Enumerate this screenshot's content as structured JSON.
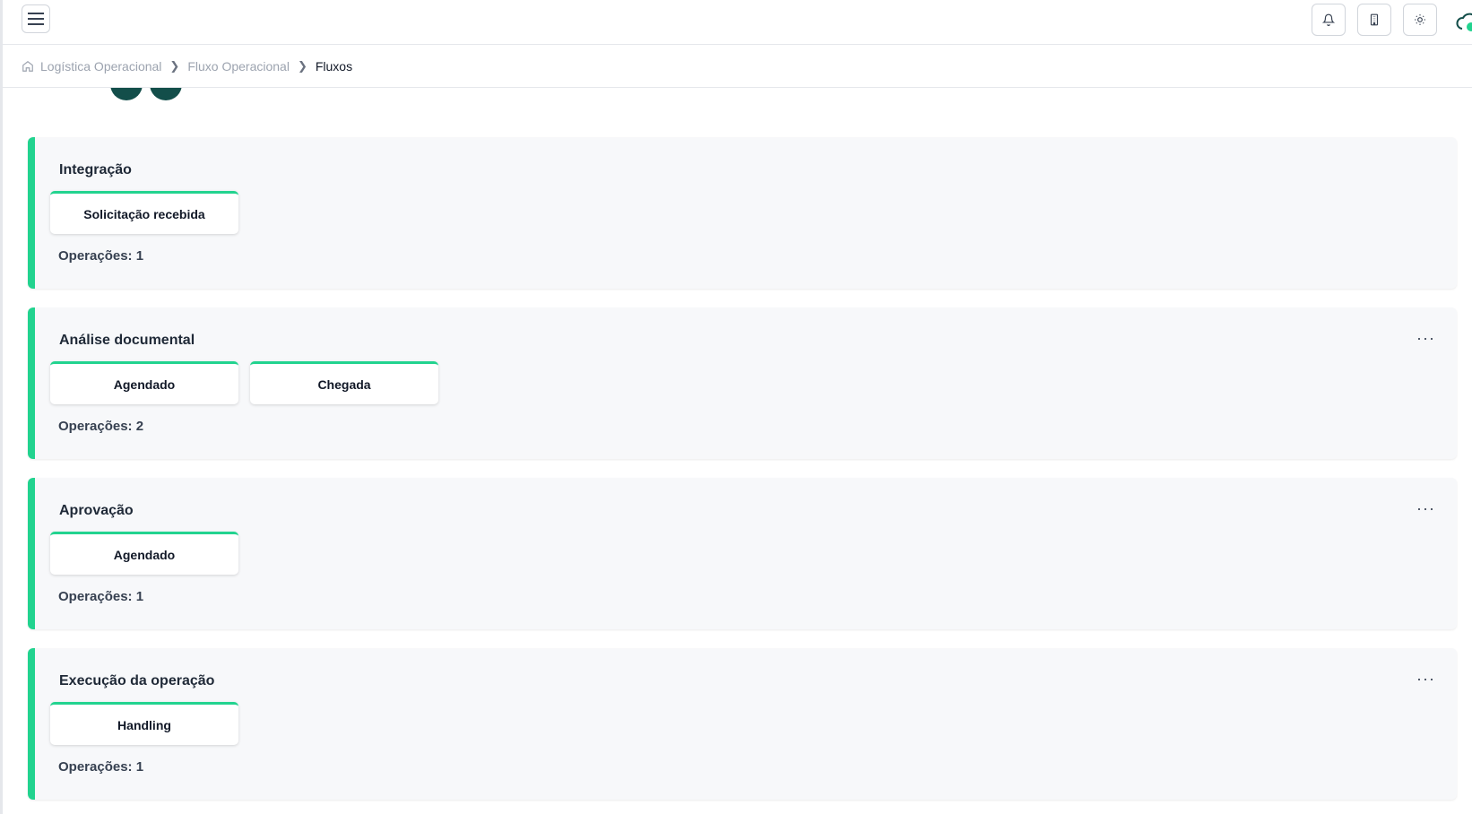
{
  "header": {
    "menu_icon": "hamburger-menu-icon",
    "actions": [
      {
        "name": "notifications-button",
        "icon": "bell-icon"
      },
      {
        "name": "building-button",
        "icon": "building-icon"
      },
      {
        "name": "theme-toggle-button",
        "icon": "sun-icon"
      }
    ],
    "logo_icon": "cloud-logo-icon"
  },
  "breadcrumb": {
    "home_icon": "home-icon",
    "items": [
      "Logística Operacional",
      "Fluxo Operacional",
      "Fluxos"
    ]
  },
  "stages": [
    {
      "title": "Integração",
      "cards": [
        "Solicitação recebida"
      ],
      "ops_label": "Operações: 1",
      "has_menu": false
    },
    {
      "title": "Análise documental",
      "cards": [
        "Agendado",
        "Chegada"
      ],
      "ops_label": "Operações: 2",
      "has_menu": true
    },
    {
      "title": "Aprovação",
      "cards": [
        "Agendado"
      ],
      "ops_label": "Operações: 1",
      "has_menu": true
    },
    {
      "title": "Execução da operação",
      "cards": [
        "Handling"
      ],
      "ops_label": "Operações: 1",
      "has_menu": true
    }
  ],
  "more_label": "···",
  "colors": {
    "accent": "#22d38f",
    "avatar": "#134e4a"
  }
}
